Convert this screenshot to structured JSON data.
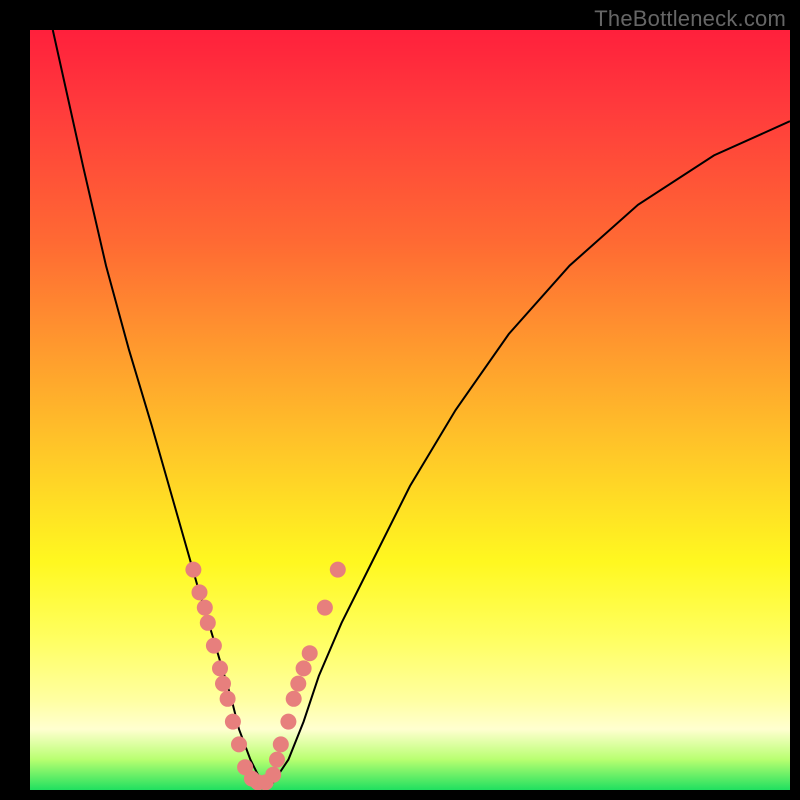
{
  "watermark": "TheBottleneck.com",
  "colors": {
    "dot": "#e77f7d",
    "curve": "#000000",
    "frame": "#000000"
  },
  "chart_data": {
    "type": "line",
    "title": "",
    "xlabel": "",
    "ylabel": "",
    "xlim": [
      0,
      100
    ],
    "ylim": [
      0,
      100
    ],
    "grid": false,
    "legend": false,
    "series": [
      {
        "name": "bottleneck-curve",
        "x": [
          3,
          7,
          10,
          13,
          16,
          18,
          20,
          22,
          23.5,
          25,
          26.5,
          27.5,
          29,
          30.5,
          32,
          34,
          36,
          38,
          41,
          45,
          50,
          56,
          63,
          71,
          80,
          90,
          100
        ],
        "values": [
          100,
          82,
          69,
          58,
          48,
          41,
          34,
          27,
          22,
          17,
          12,
          8,
          4,
          1,
          1,
          4,
          9,
          15,
          22,
          30,
          40,
          50,
          60,
          69,
          77,
          83.5,
          88
        ]
      }
    ],
    "points": [
      {
        "x": 21.5,
        "y": 29
      },
      {
        "x": 22.3,
        "y": 26
      },
      {
        "x": 23.0,
        "y": 24
      },
      {
        "x": 23.4,
        "y": 22
      },
      {
        "x": 24.2,
        "y": 19
      },
      {
        "x": 25.0,
        "y": 16
      },
      {
        "x": 25.4,
        "y": 14
      },
      {
        "x": 26.0,
        "y": 12
      },
      {
        "x": 26.7,
        "y": 9
      },
      {
        "x": 27.5,
        "y": 6
      },
      {
        "x": 28.3,
        "y": 3
      },
      {
        "x": 29.2,
        "y": 1.5
      },
      {
        "x": 30.0,
        "y": 1
      },
      {
        "x": 31.0,
        "y": 1
      },
      {
        "x": 32.0,
        "y": 2
      },
      {
        "x": 32.5,
        "y": 4
      },
      {
        "x": 33.0,
        "y": 6
      },
      {
        "x": 34.0,
        "y": 9
      },
      {
        "x": 34.7,
        "y": 12
      },
      {
        "x": 35.3,
        "y": 14
      },
      {
        "x": 36.0,
        "y": 16
      },
      {
        "x": 36.8,
        "y": 18
      },
      {
        "x": 38.8,
        "y": 24
      },
      {
        "x": 40.5,
        "y": 29
      }
    ]
  }
}
